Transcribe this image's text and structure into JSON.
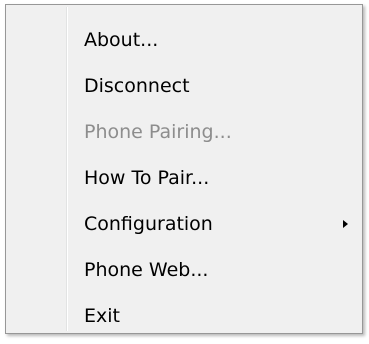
{
  "menu": {
    "items": [
      {
        "label": "About...",
        "enabled": true
      },
      {
        "label": "Disconnect",
        "enabled": true
      },
      {
        "label": "Phone Pairing...",
        "enabled": false
      },
      {
        "label": "How To Pair...",
        "enabled": true
      },
      {
        "label": "Configuration",
        "enabled": true,
        "submenu_icon": "chevron-right-icon"
      },
      {
        "label": "Phone Web...",
        "enabled": true
      },
      {
        "label": "Exit",
        "enabled": true
      }
    ]
  },
  "colors": {
    "menu_background": "#f0f0f0",
    "border": "#979797",
    "text": "#000000",
    "disabled_text": "#8d8d8d"
  }
}
